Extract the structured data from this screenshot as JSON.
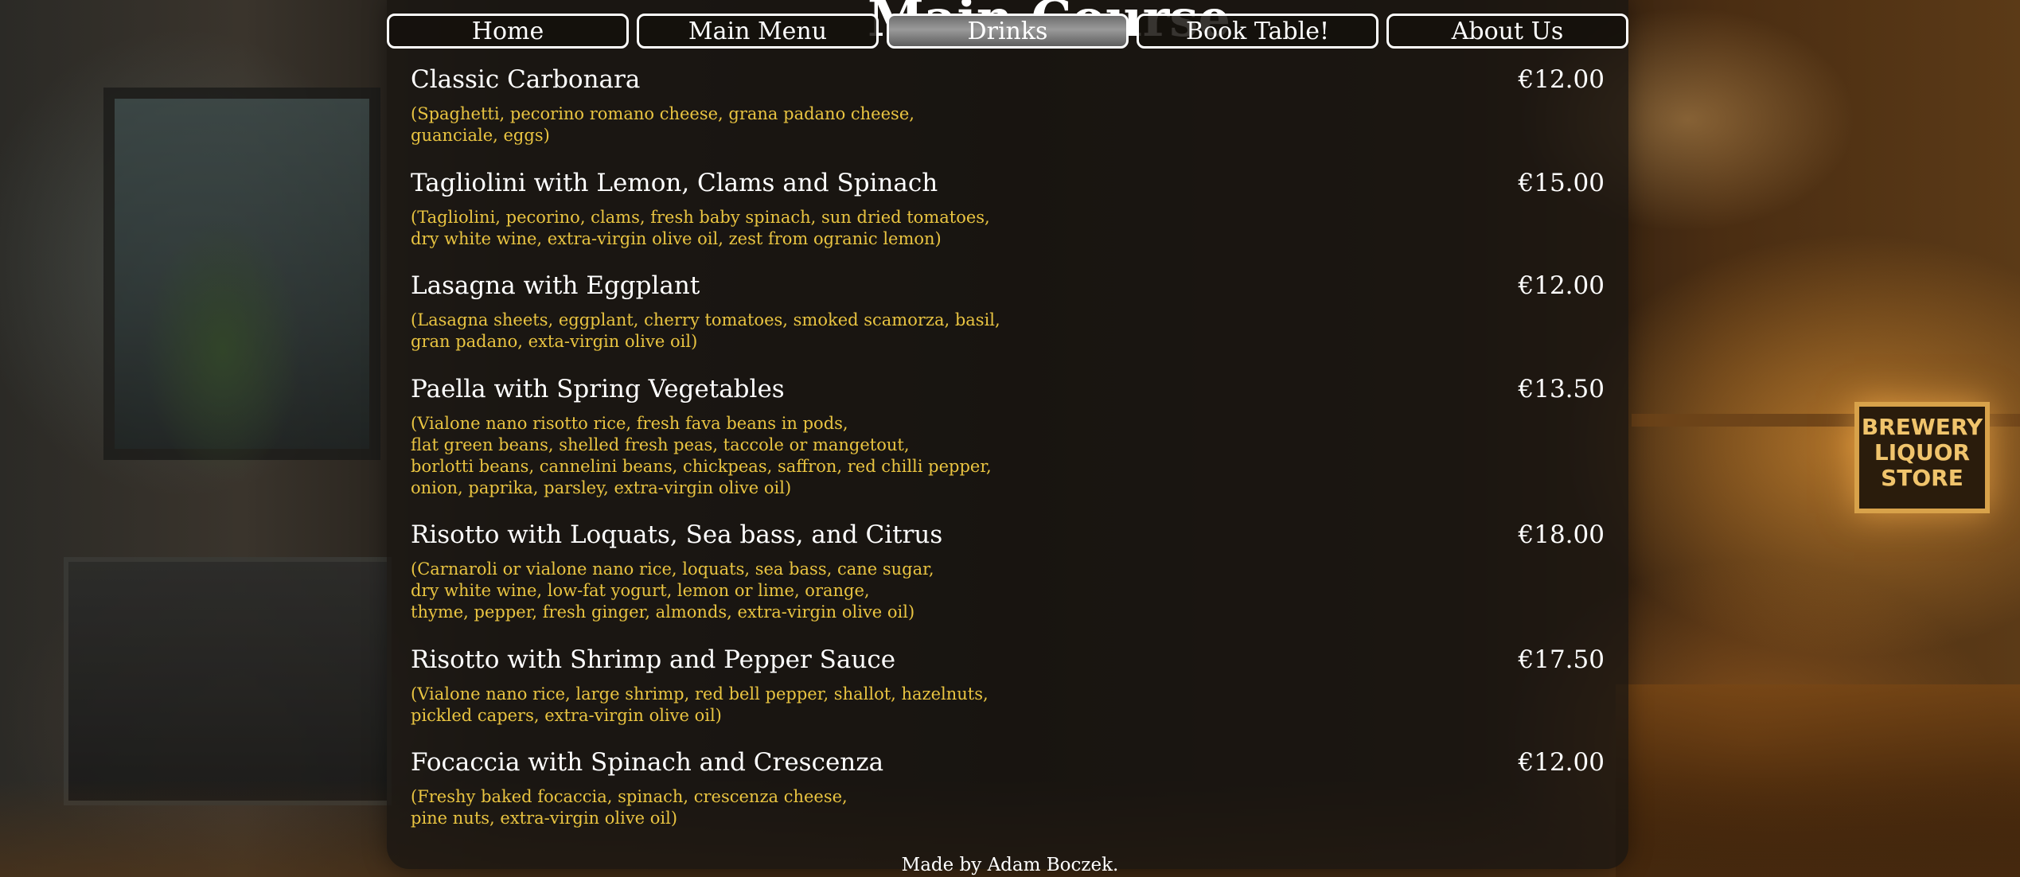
{
  "background": {
    "sign_text": "BREWERY LIQUOR STORE"
  },
  "heading": "Main Course",
  "nav": {
    "items": [
      {
        "label": "Home"
      },
      {
        "label": "Main Menu"
      },
      {
        "label": "Drinks"
      },
      {
        "label": "Book Table!"
      },
      {
        "label": "About Us"
      }
    ],
    "active_index": 2
  },
  "menu": {
    "items": [
      {
        "name": "Classic Carbonara",
        "price": "€12.00",
        "description": "(Spaghetti, pecorino romano cheese, grana padano cheese,\nguanciale, eggs)"
      },
      {
        "name": "Tagliolini with Lemon, Clams and Spinach",
        "price": "€15.00",
        "description": "(Tagliolini, pecorino, clams, fresh baby spinach, sun dried tomatoes,\ndry white wine, extra-virgin olive oil, zest from ogranic lemon)"
      },
      {
        "name": "Lasagna with Eggplant",
        "price": "€12.00",
        "description": "(Lasagna sheets, eggplant, cherry tomatoes, smoked scamorza, basil,\ngran padano, exta-virgin olive oil)"
      },
      {
        "name": "Paella with Spring Vegetables",
        "price": "€13.50",
        "description": "(Vialone nano risotto rice, fresh fava beans in pods,\nflat green beans, shelled fresh peas, taccole or mangetout,\nborlotti beans, cannelini beans, chickpeas, saffron, red chilli pepper,\nonion, paprika, parsley, extra-virgin olive oil)"
      },
      {
        "name": "Risotto with Loquats, Sea bass, and Citrus",
        "price": "€18.00",
        "description": "(Carnaroli or vialone nano rice, loquats, sea bass, cane sugar,\ndry white wine, low-fat yogurt, lemon or lime, orange,\nthyme, pepper, fresh ginger, almonds, extra-virgin olive oil)"
      },
      {
        "name": "Risotto with Shrimp and Pepper Sauce",
        "price": "€17.50",
        "description": "(Vialone nano rice, large shrimp, red bell pepper, shallot, hazelnuts,\npickled capers, extra-virgin olive oil)"
      },
      {
        "name": "Focaccia with Spinach and Crescenza",
        "price": "€12.00",
        "description": "(Freshy baked focaccia, spinach, crescenza cheese,\npine nuts, extra-virgin olive oil)"
      }
    ]
  },
  "footer": {
    "text": "Made by Adam Boczek."
  }
}
